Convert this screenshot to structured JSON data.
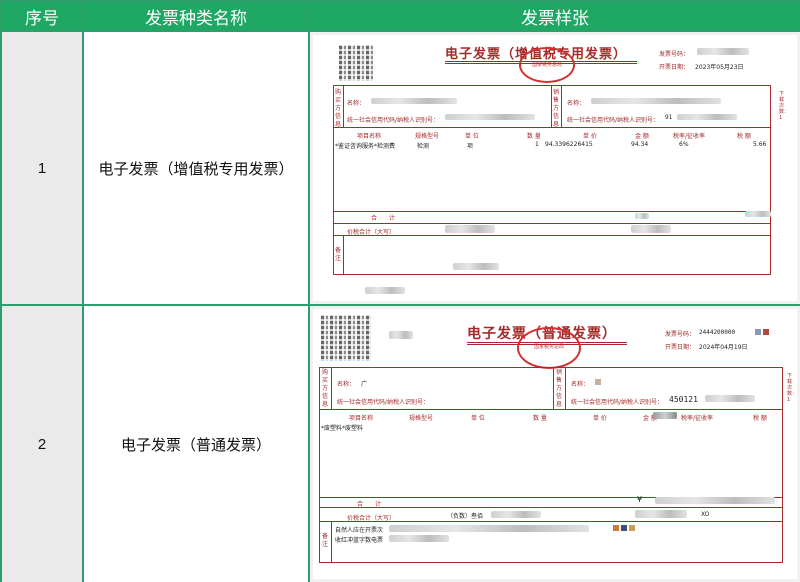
{
  "headers": {
    "index": "序号",
    "type_name": "发票种类名称",
    "sample": "发票样张"
  },
  "colors": {
    "header_bg": "#1ea864",
    "border": "#2e9e6d",
    "invoice_ink": "#a52a2a",
    "seal": "#d23131"
  },
  "rows": [
    {
      "index": "1",
      "name": "电子发票（增值税专用发票）"
    },
    {
      "index": "2",
      "name": "电子发票（普通发票）"
    }
  ],
  "invoice1": {
    "title": "电子发票（增值税专用发票）",
    "invoice_no_label": "发票号码：",
    "date_label": "开票日期：",
    "date": "2023年05月23日",
    "buyer_side": "购买方信息",
    "seller_side": "销售方信息",
    "name_label": "名称：",
    "taxid_label": "统一社会信用代码/纳税人识别号：",
    "seller_taxid_prefix": "91",
    "cols": [
      "项目名称",
      "规格型号",
      "单 位",
      "数 量",
      "单 价",
      "金 额",
      "税率/征收率",
      "税 额"
    ],
    "item": [
      "*鉴证咨询服务*检测费",
      "检测",
      "项",
      "1",
      "94.3396226415",
      "94.34",
      "6%",
      "5.66"
    ],
    "total_label": "合　　计",
    "total_tax_label": "价税合计（大写）",
    "remark_label": "备注",
    "side_note": "下载次数：1",
    "seal_text": "国家税务总局"
  },
  "invoice2": {
    "title": "电子发票（普通发票）",
    "invoice_no_label": "发票号码：",
    "invoice_no": "2444200000",
    "date_label": "开票日期：",
    "date": "2024年04月19日",
    "buyer_side": "购买方信息",
    "seller_side": "销售方信息",
    "name_label": "名称：",
    "buyer_name_prefix": "广",
    "taxid_label": "统一社会信用代码/纳税人识别号：",
    "seller_taxid_prefix": "450121",
    "cols": [
      "项目名称",
      "规格型号",
      "单 位",
      "数 量",
      "单 价",
      "金 额",
      "税率/征收率",
      "税 额"
    ],
    "item": [
      "*废塑料*废塑料"
    ],
    "total_label": "合　　计",
    "total_tax_label": "价税合计（大写）",
    "negative_label": "（负数）叁佰",
    "total_symbol": "¥",
    "remark_label": "备注",
    "remark_line1": "自然人应在开票次",
    "remark_line2": "收红冲蓝字数电票",
    "side_note": "下载次数：1",
    "seal_text": "国家税务总局"
  }
}
